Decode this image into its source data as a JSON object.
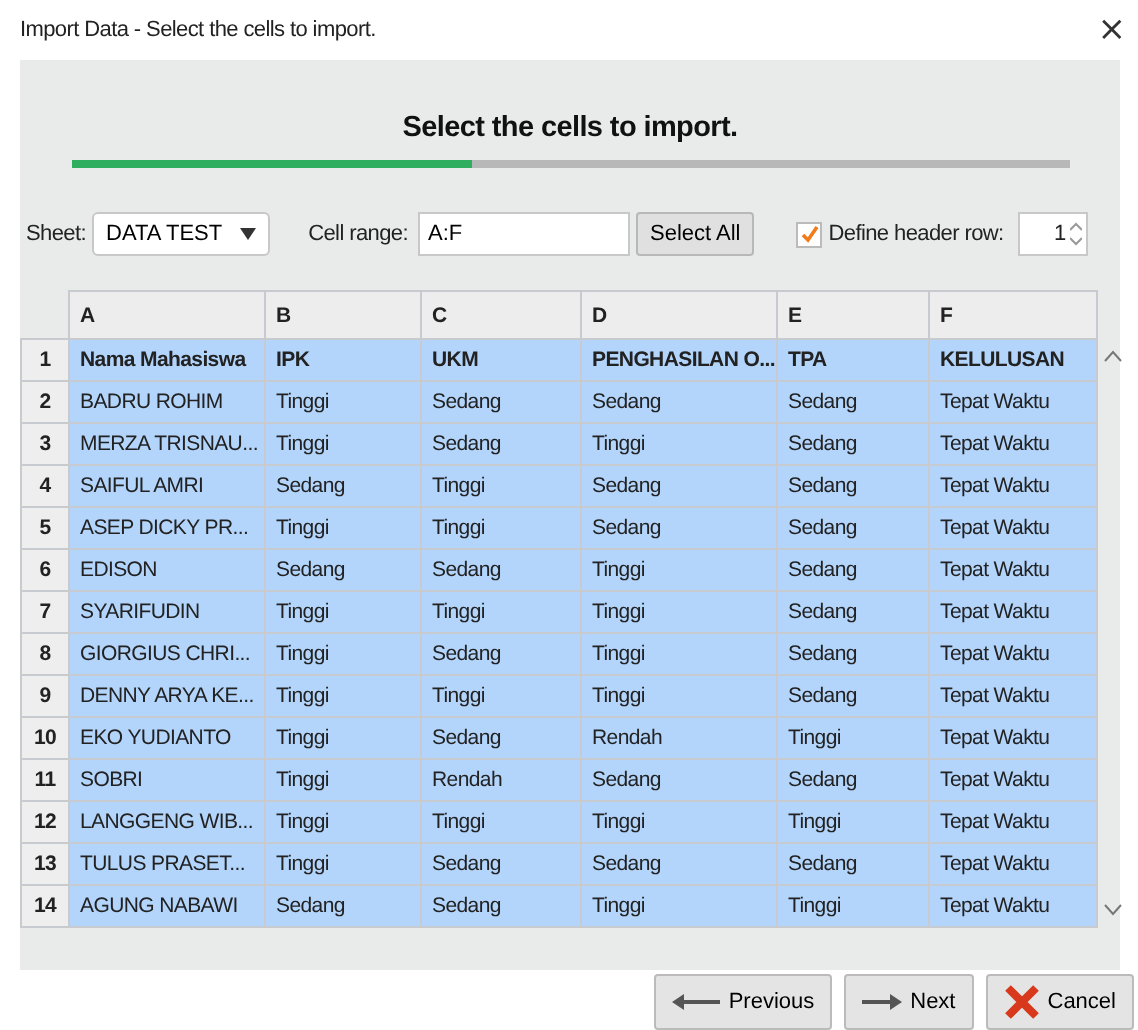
{
  "window": {
    "title": "Import Data - Select the cells to import.",
    "close": "×"
  },
  "heading": "Select the cells to import.",
  "progress": {
    "level": 0.4
  },
  "controls": {
    "sheet_label": "Sheet:",
    "sheet_value": "DATA TEST",
    "range_label": "Cell range:",
    "range_value": "A:F",
    "select_all": "Select All",
    "header_row_label": "Define header row:",
    "header_row_checked": true,
    "header_row_value": "1"
  },
  "table": {
    "columns": [
      "A",
      "B",
      "C",
      "D",
      "E",
      "F"
    ],
    "rows": [
      {
        "number": "1",
        "selected": true,
        "cells": [
          "Nama Mahasiswa",
          "IPK",
          "UKM",
          "PENGHASILAN O...",
          "TPA",
          "KELULUSAN"
        ]
      },
      {
        "number": "2",
        "selected": true,
        "cells": [
          "BADRU ROHIM",
          "Tinggi",
          "Sedang",
          "Sedang",
          "Sedang",
          "Tepat Waktu"
        ]
      },
      {
        "number": "3",
        "selected": true,
        "cells": [
          "MERZA TRISNAU...",
          "Tinggi",
          "Sedang",
          "Tinggi",
          "Sedang",
          "Tepat Waktu"
        ]
      },
      {
        "number": "4",
        "selected": true,
        "cells": [
          "SAIFUL AMRI",
          "Sedang",
          "Tinggi",
          "Sedang",
          "Sedang",
          "Tepat Waktu"
        ]
      },
      {
        "number": "5",
        "selected": true,
        "cells": [
          "ASEP DICKY PR...",
          "Tinggi",
          "Tinggi",
          "Sedang",
          "Sedang",
          "Tepat Waktu"
        ]
      },
      {
        "number": "6",
        "selected": true,
        "cells": [
          "EDISON",
          "Sedang",
          "Sedang",
          "Tinggi",
          "Sedang",
          "Tepat Waktu"
        ]
      },
      {
        "number": "7",
        "selected": true,
        "cells": [
          "SYARIFUDIN",
          "Tinggi",
          "Tinggi",
          "Tinggi",
          "Sedang",
          "Tepat Waktu"
        ]
      },
      {
        "number": "8",
        "selected": true,
        "cells": [
          "GIORGIUS CHRI...",
          "Tinggi",
          "Sedang",
          "Tinggi",
          "Sedang",
          "Tepat Waktu"
        ]
      },
      {
        "number": "9",
        "selected": true,
        "cells": [
          "DENNY ARYA KE...",
          "Tinggi",
          "Tinggi",
          "Tinggi",
          "Sedang",
          "Tepat Waktu"
        ]
      },
      {
        "number": "10",
        "selected": true,
        "cells": [
          "EKO YUDIANTO",
          "Tinggi",
          "Sedang",
          "Rendah",
          "Tinggi",
          "Tepat Waktu"
        ]
      },
      {
        "number": "11",
        "selected": true,
        "cells": [
          "SOBRI",
          "Tinggi",
          "Rendah",
          "Sedang",
          "Sedang",
          "Tepat Waktu"
        ]
      },
      {
        "number": "12",
        "selected": true,
        "cells": [
          "LANGGENG WIB...",
          "Tinggi",
          "Tinggi",
          "Tinggi",
          "Tinggi",
          "Tepat Waktu"
        ]
      },
      {
        "number": "13",
        "selected": true,
        "cells": [
          "TULUS PRASET...",
          "Tinggi",
          "Sedang",
          "Sedang",
          "Sedang",
          "Tepat Waktu"
        ]
      },
      {
        "number": "14",
        "selected": true,
        "cells": [
          "AGUNG NABAWI",
          "Sedang",
          "Sedang",
          "Tinggi",
          "Tinggi",
          "Tepat Waktu"
        ]
      }
    ]
  },
  "buttons": [
    {
      "kind": "previous",
      "label": "Previous"
    },
    {
      "kind": "next",
      "label": "Next"
    },
    {
      "kind": "cancel",
      "label": "Cancel"
    }
  ]
}
